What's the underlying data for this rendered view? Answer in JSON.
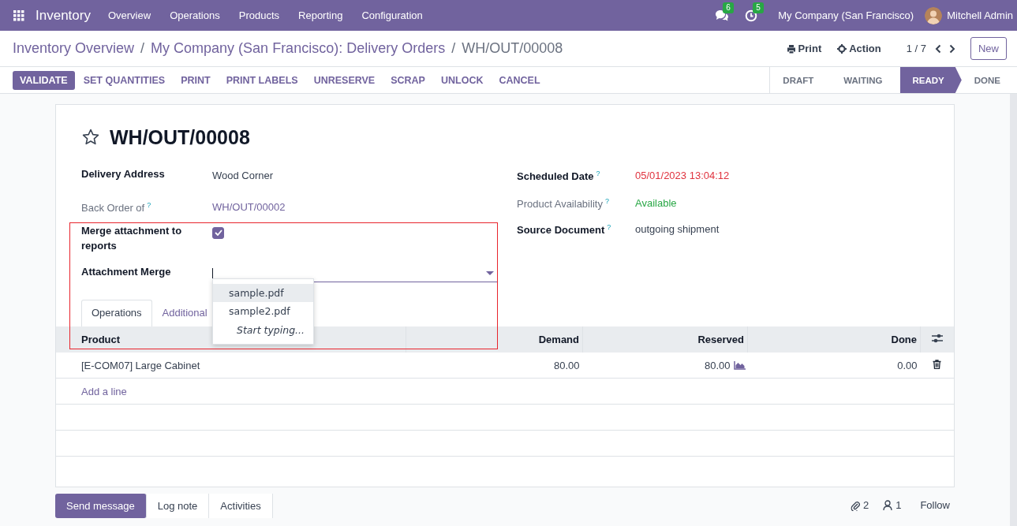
{
  "navbar": {
    "app": "Inventory",
    "menu": [
      "Overview",
      "Operations",
      "Products",
      "Reporting",
      "Configuration"
    ],
    "messages_badge": "6",
    "activities_badge": "5",
    "company": "My Company (San Francisco)",
    "user": "Mitchell Admin"
  },
  "breadcrumb": {
    "separator": "/",
    "items": [
      {
        "label": "Inventory Overview",
        "kind": "link"
      },
      {
        "label": "My Company (San Francisco): Delivery Orders",
        "kind": "link"
      },
      {
        "label": "WH/OUT/00008",
        "kind": "current"
      }
    ]
  },
  "toolbar": {
    "print": "Print",
    "action": "Action",
    "pager": "1 / 7",
    "new": "New"
  },
  "buttons": [
    {
      "label": "VALIDATE",
      "primary": true
    },
    {
      "label": "SET QUANTITIES",
      "primary": false
    },
    {
      "label": "PRINT",
      "primary": false
    },
    {
      "label": "PRINT LABELS",
      "primary": false
    },
    {
      "label": "UNRESERVE",
      "primary": false
    },
    {
      "label": "SCRAP",
      "primary": false
    },
    {
      "label": "UNLOCK",
      "primary": false
    },
    {
      "label": "CANCEL",
      "primary": false
    }
  ],
  "stages": [
    {
      "label": "DRAFT",
      "selected": false
    },
    {
      "label": "WAITING",
      "selected": false
    },
    {
      "label": "READY",
      "selected": true
    },
    {
      "label": "DONE",
      "selected": false
    }
  ],
  "record": {
    "title": "WH/OUT/00008",
    "starred": false,
    "left_fields": [
      {
        "kind": "text",
        "label": "Delivery Address",
        "bold": true,
        "value": "Wood Corner"
      },
      {
        "kind": "link",
        "label": "Back Order of",
        "bold": false,
        "help": "?",
        "value": "WH/OUT/00002"
      },
      {
        "kind": "checkbox",
        "label": "Merge attachment to reports",
        "bold": true,
        "checked": true
      },
      {
        "kind": "dropdown",
        "label": "Attachment Merge",
        "bold": true
      }
    ],
    "right_fields": [
      {
        "kind": "text",
        "label": "Scheduled Date",
        "bold": true,
        "help": "?",
        "value": "05/01/2023 13:04:12",
        "color": "#e0323e"
      },
      {
        "kind": "text",
        "label": "Product Availability",
        "bold": false,
        "help": "?",
        "value": "Available",
        "color": "#28a745"
      },
      {
        "kind": "text",
        "label": "Source Document",
        "bold": true,
        "help": "?",
        "value": "outgoing shipment",
        "color": "#374151"
      }
    ]
  },
  "dropdown": {
    "options": [
      {
        "label": "sample.pdf",
        "selected": true
      },
      {
        "label": "sample2.pdf",
        "selected": false
      }
    ],
    "hint": "Start typing..."
  },
  "tabs": [
    {
      "label": "Operations",
      "selected": true
    },
    {
      "label": "Additional",
      "selected": false
    }
  ],
  "table": {
    "columns": [
      "Product",
      "Demand",
      "Reserved",
      "Done"
    ],
    "rows": [
      {
        "cells": [
          "[E-COM07] Large Cabinet",
          "80.00",
          "80.00",
          "0.00"
        ]
      }
    ],
    "add_line": "Add a line"
  },
  "chatter": {
    "buttons": [
      {
        "label": "Send message",
        "primary": true
      },
      {
        "label": "Log note",
        "primary": false
      },
      {
        "label": "Activities",
        "primary": false
      }
    ],
    "attachments": "2",
    "followers": "1",
    "follow": "Follow"
  }
}
